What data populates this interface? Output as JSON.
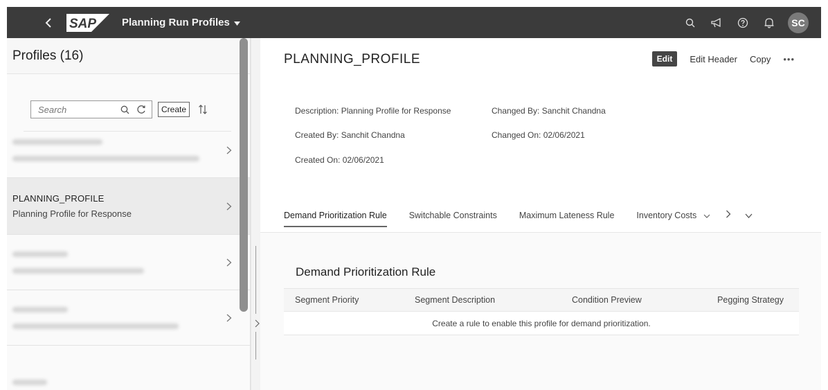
{
  "shell": {
    "app_title": "Planning Run Profiles",
    "logo_text": "SAP",
    "avatar_initials": "SC",
    "icons": [
      "back-icon",
      "search-icon",
      "megaphone-icon",
      "help-icon",
      "bell-icon"
    ]
  },
  "master": {
    "title": "Profiles (16)",
    "search_placeholder": "Search",
    "create_label": "Create",
    "items": [
      {
        "title": "",
        "description": "",
        "blurred": true
      },
      {
        "title": "PLANNING_PROFILE",
        "description": "Planning Profile for Response",
        "blurred": false,
        "selected": true
      },
      {
        "title": "",
        "description": "",
        "blurred": true
      },
      {
        "title": "",
        "description": "",
        "blurred": true
      },
      {
        "title": "",
        "description": "",
        "blurred": true
      }
    ]
  },
  "detail": {
    "title": "PLANNING_PROFILE",
    "actions": {
      "edit": "Edit",
      "edit_header": "Edit Header",
      "copy": "Copy",
      "more": "•••"
    },
    "meta": {
      "description": "Description: Planning Profile for Response",
      "created_by": "Created By: Sanchit Chandna",
      "created_on": "Created On: 02/06/2021",
      "changed_by": "Changed By: Sanchit Chandna",
      "changed_on": "Changed On: 02/06/2021"
    },
    "tabs": [
      "Demand Prioritization Rule",
      "Switchable Constraints",
      "Maximum Lateness Rule",
      "Inventory Costs"
    ],
    "active_tab": "Demand Prioritization Rule",
    "section_title": "Demand Prioritization Rule",
    "table": {
      "columns": [
        "Segment Priority",
        "Segment Description",
        "Condition Preview",
        "Pegging Strategy"
      ],
      "empty_text": "Create a rule to enable this profile for demand prioritization."
    }
  },
  "colors": {
    "shell_bg": "#3b3b3b",
    "edit_button": "#454545",
    "selected_item": "#ebebeb"
  }
}
